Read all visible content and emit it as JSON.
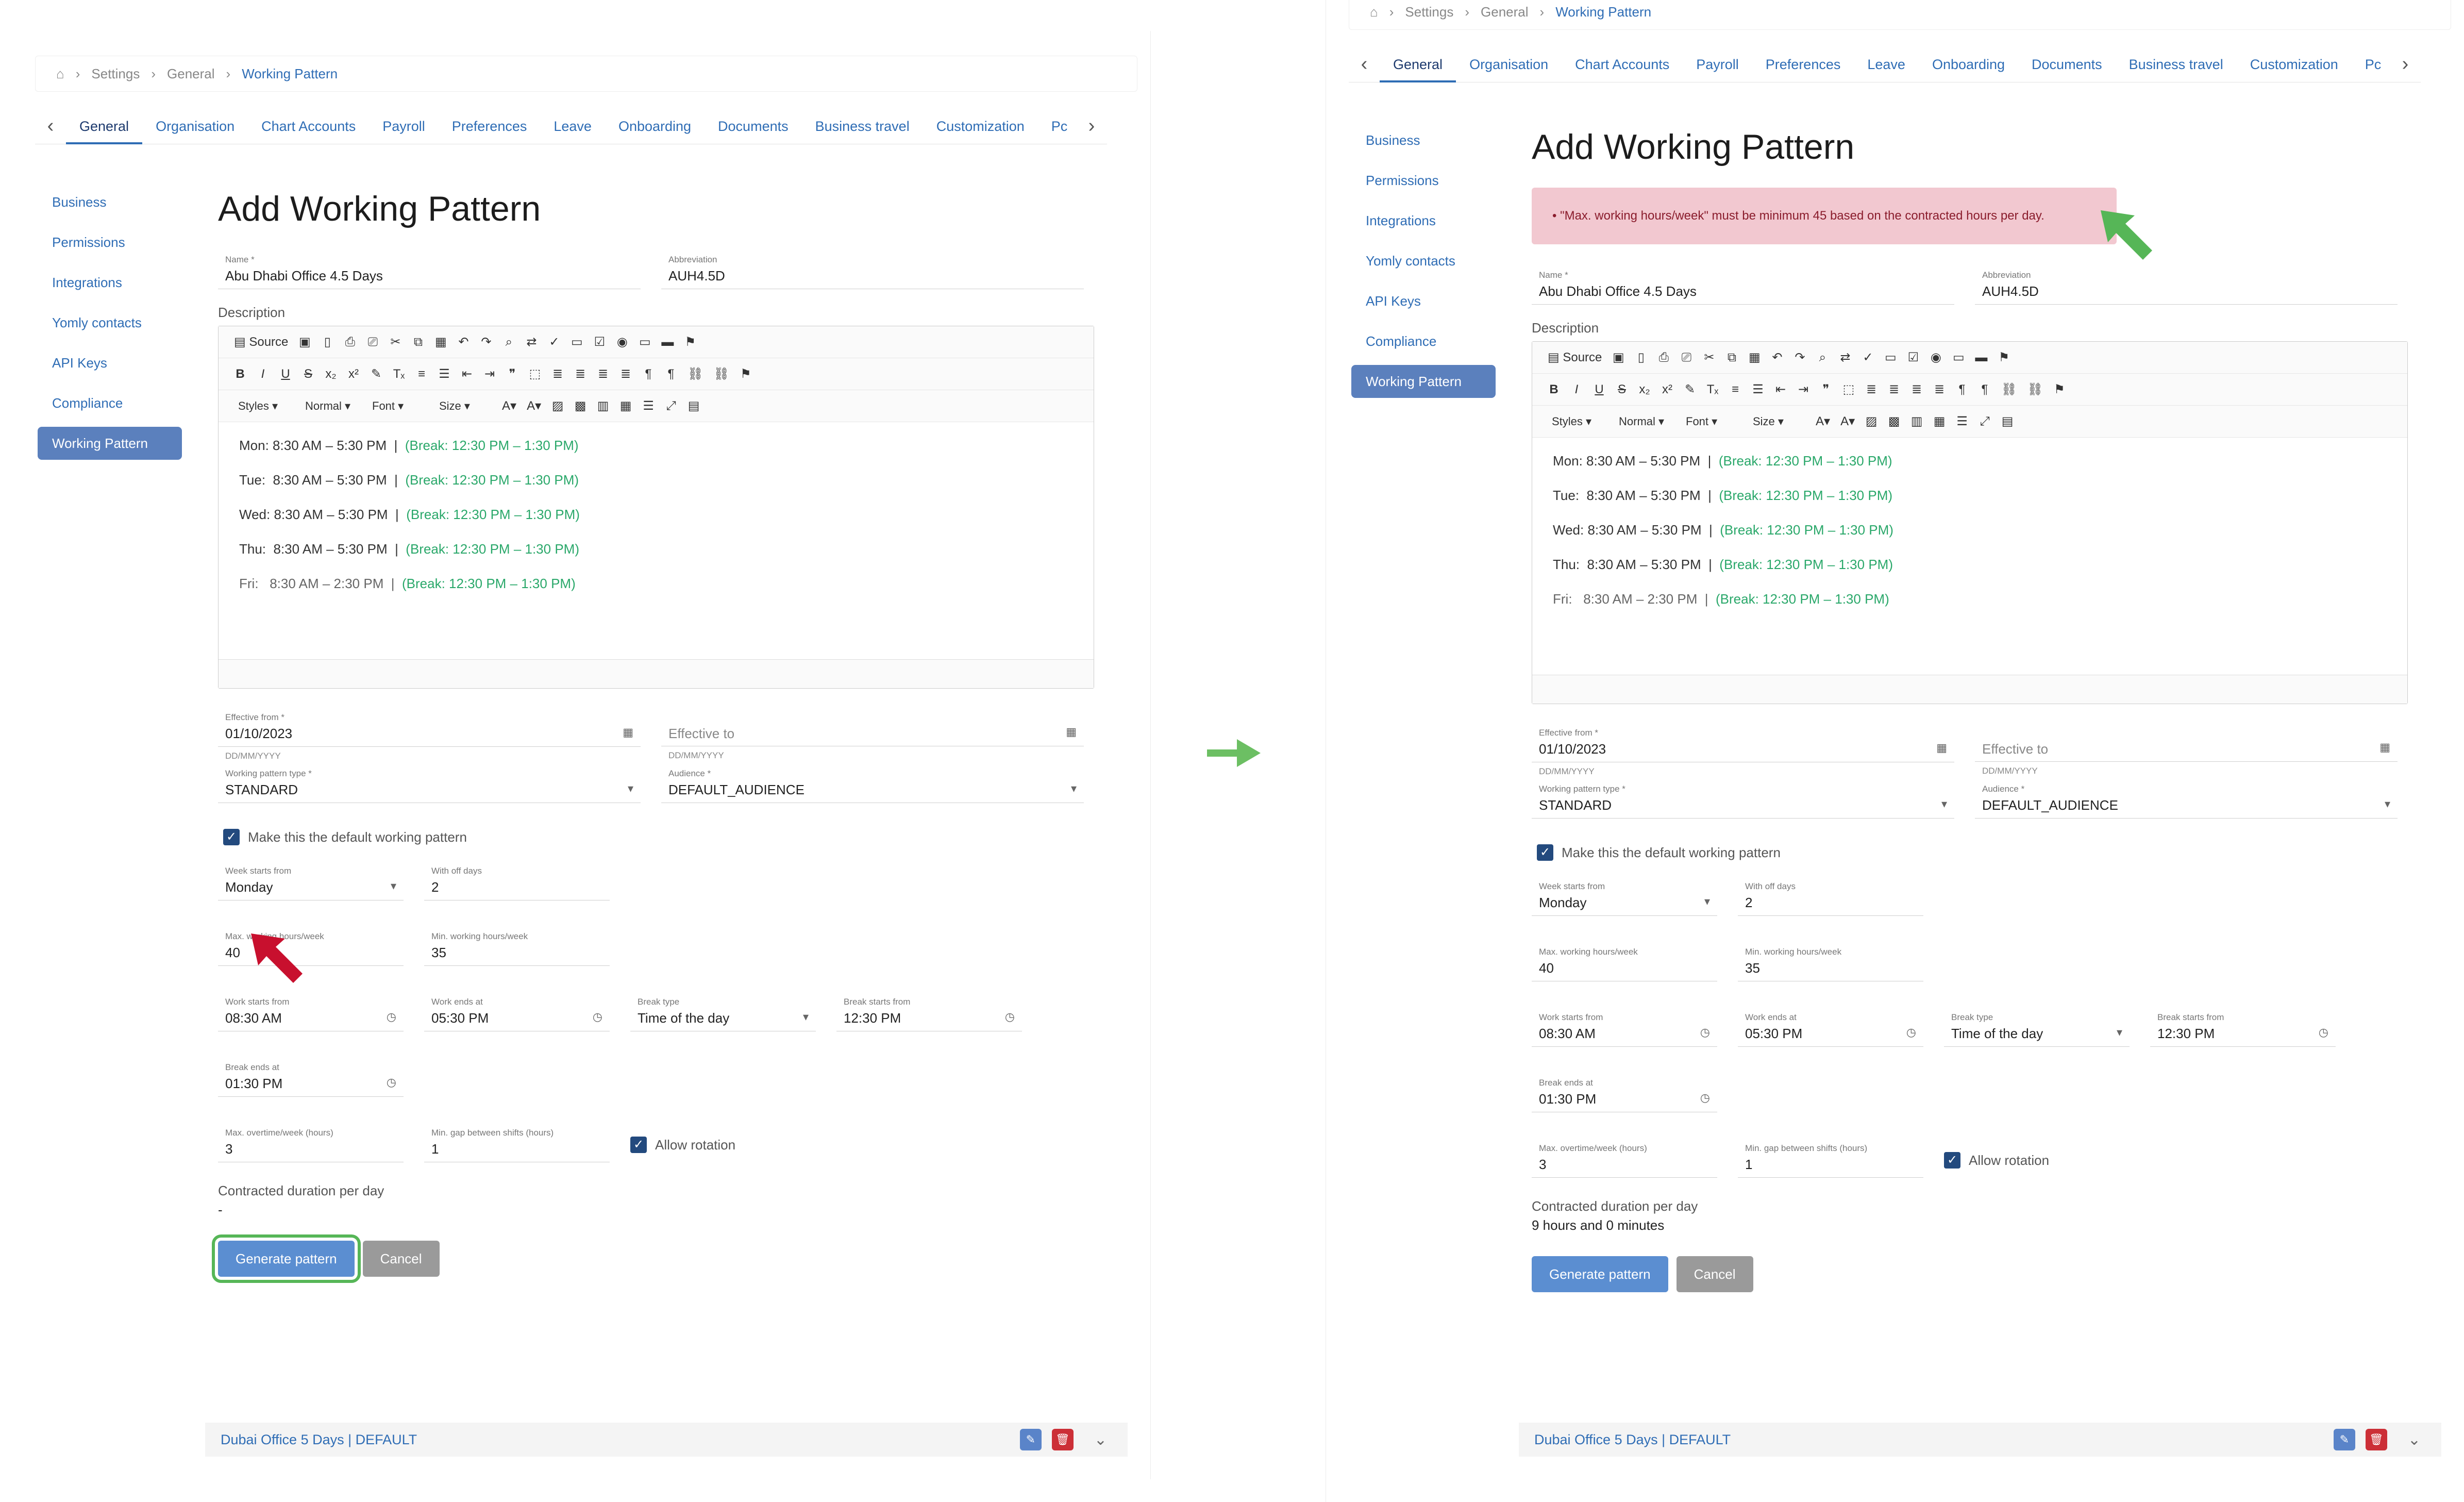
{
  "breadcrumb": {
    "items": [
      "Settings",
      "General",
      "Working Pattern"
    ]
  },
  "tabs": [
    "General",
    "Organisation",
    "Chart Accounts",
    "Payroll",
    "Preferences",
    "Leave",
    "Onboarding",
    "Documents",
    "Business travel",
    "Customization",
    "Pc"
  ],
  "sidebar": [
    "Business",
    "Permissions",
    "Integrations",
    "Yomly contacts",
    "API Keys",
    "Compliance",
    "Working Pattern"
  ],
  "page_title": "Add Working Pattern",
  "alert": "•  \"Max. working hours/week\" must be minimum 45 based on the contracted hours per day.",
  "form": {
    "name_label": "Name *",
    "name_value": "Abu Dhabi Office 4.5 Days",
    "abbr_label": "Abbreviation",
    "abbr_value": "AUH4.5D",
    "desc_label": "Description",
    "toolbar": {
      "source": "Source",
      "styles": "Styles",
      "normal": "Normal",
      "font": "Font",
      "size": "Size"
    },
    "schedule": [
      {
        "day": "Mon:",
        "time": "8:30 AM – 5:30 PM",
        "break": "(Break: 12:30 PM – 1:30 PM)"
      },
      {
        "day": "Tue:",
        "time": "8:30 AM – 5:30 PM",
        "break": "(Break: 12:30 PM – 1:30 PM)"
      },
      {
        "day": "Wed:",
        "time": "8:30 AM – 5:30 PM",
        "break": "(Break: 12:30 PM – 1:30 PM)"
      },
      {
        "day": "Thu:",
        "time": "8:30 AM – 5:30 PM",
        "break": "(Break: 12:30 PM – 1:30 PM)"
      },
      {
        "day": "Fri:",
        "time": "8:30 AM – 2:30 PM",
        "break": "(Break: 12:30 PM – 1:30 PM)"
      }
    ],
    "eff_from_label": "Effective from *",
    "eff_from_value": "01/10/2023",
    "date_hint": "DD/MM/YYYY",
    "eff_to_label": "Effective to",
    "type_label": "Working pattern type *",
    "type_value": "STANDARD",
    "aud_label": "Audience *",
    "aud_value": "DEFAULT_AUDIENCE",
    "default_chk": "Make this the default working pattern",
    "week_label": "Week starts from",
    "week_value": "Monday",
    "off_label": "With off days",
    "off_value": "2",
    "max_label": "Max. working hours/week",
    "max_value": "40",
    "min_label": "Min. working hours/week",
    "min_value": "35",
    "ws_label": "Work starts from",
    "ws_value": "08:30 AM",
    "we_label": "Work ends at",
    "we_value": "05:30 PM",
    "bt_label": "Break type",
    "bt_value": "Time of the day",
    "bs_label": "Break starts from",
    "bs_value": "12:30 PM",
    "be_label": "Break ends at",
    "be_value": "01:30 PM",
    "ot_label": "Max. overtime/week (hours)",
    "ot_value": "3",
    "gap_label": "Min. gap between shifts (hours)",
    "gap_value": "1",
    "rot_label": "Allow rotation",
    "contr_label": "Contracted duration per day",
    "contr_before": "-",
    "contr_after": "9 hours and 0 minutes",
    "gen_btn": "Generate pattern",
    "cancel_btn": "Cancel"
  },
  "accordion": "Dubai Office 5 Days | DEFAULT",
  "icons": {
    "home": "home-icon",
    "edit": "pencil-icon",
    "delete": "trash-icon",
    "chevron": "chevron-down-icon",
    "calendar": "calendar-icon",
    "clock": "clock-icon"
  },
  "colors": {
    "accent": "#2f6db5",
    "active_nav": "#5b80bd",
    "primary_btn": "#5b8ed1",
    "alert_bg": "#f2c8d0",
    "break_text": "#2aa86a",
    "red_arrow": "#c8102e",
    "green_arrow": "#56b657"
  }
}
